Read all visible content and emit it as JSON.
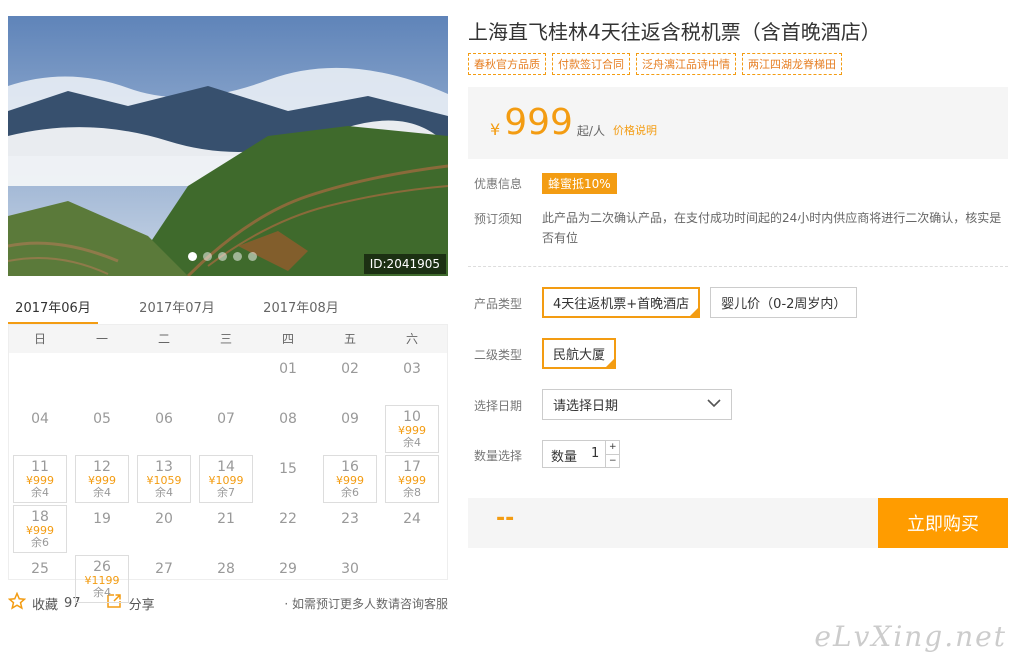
{
  "photo": {
    "id_label": "ID:2041905",
    "slides": [
      true,
      false,
      false,
      false,
      false
    ]
  },
  "months": [
    "2017年06月",
    "2017年07月",
    "2017年08月"
  ],
  "weekdays": [
    "日",
    "一",
    "二",
    "三",
    "四",
    "五",
    "六"
  ],
  "calendar": [
    {
      "d": ""
    },
    {
      "d": ""
    },
    {
      "d": ""
    },
    {
      "d": ""
    },
    {
      "d": "01"
    },
    {
      "d": "02"
    },
    {
      "d": "03"
    },
    {
      "d": "04"
    },
    {
      "d": "05"
    },
    {
      "d": "06"
    },
    {
      "d": "07"
    },
    {
      "d": "08"
    },
    {
      "d": "09"
    },
    {
      "d": "10",
      "p": "¥999",
      "s": "余4"
    },
    {
      "d": "11",
      "p": "¥999",
      "s": "余4"
    },
    {
      "d": "12",
      "p": "¥999",
      "s": "余4"
    },
    {
      "d": "13",
      "p": "¥1059",
      "s": "余4"
    },
    {
      "d": "14",
      "p": "¥1099",
      "s": "余7"
    },
    {
      "d": "15"
    },
    {
      "d": "16",
      "p": "¥999",
      "s": "余6"
    },
    {
      "d": "17",
      "p": "¥999",
      "s": "余8"
    },
    {
      "d": "18",
      "p": "¥999",
      "s": "余6"
    },
    {
      "d": "19"
    },
    {
      "d": "20"
    },
    {
      "d": "21"
    },
    {
      "d": "22"
    },
    {
      "d": "23"
    },
    {
      "d": "24"
    },
    {
      "d": "25"
    },
    {
      "d": "26",
      "p": "¥1199",
      "s": "余4"
    },
    {
      "d": "27"
    },
    {
      "d": "28"
    },
    {
      "d": "29"
    },
    {
      "d": "30"
    },
    {
      "d": ""
    }
  ],
  "footer": {
    "fav_label": "收藏",
    "fav_count": "97",
    "share_label": "分享",
    "note": "· 如需预订更多人数请咨询客服"
  },
  "product": {
    "title": "上海直飞桂林4天往返含税机票（含首晚酒店）",
    "tags": [
      "春秋官方品质",
      "付款签订合同",
      "泛舟漓江品诗中情",
      "两江四湖龙脊梯田"
    ],
    "yen": "¥",
    "price": "999",
    "unit": "起/人",
    "price_explain": "价格说明",
    "discount_label": "优惠信息",
    "discount": "蜂蜜抵10%",
    "notice_label": "预订须知",
    "notice": "此产品为二次确认产品，在支付成功时间起的24小时内供应商将进行二次确认，核实是否有位",
    "type_label": "产品类型",
    "types": [
      "4天往返机票+首晚酒店",
      "婴儿价（0-2周岁内）"
    ],
    "subtype_label": "二级类型",
    "subtype": "民航大厦",
    "date_label": "选择日期",
    "date_placeholder": "请选择日期",
    "qty_label": "数量选择",
    "qty_prefix": "数量",
    "qty_value": "1",
    "qty_plus": "+",
    "qty_minus": "−",
    "total": "--",
    "buy_label": "立即购买"
  },
  "watermark": "eLvXing.net"
}
